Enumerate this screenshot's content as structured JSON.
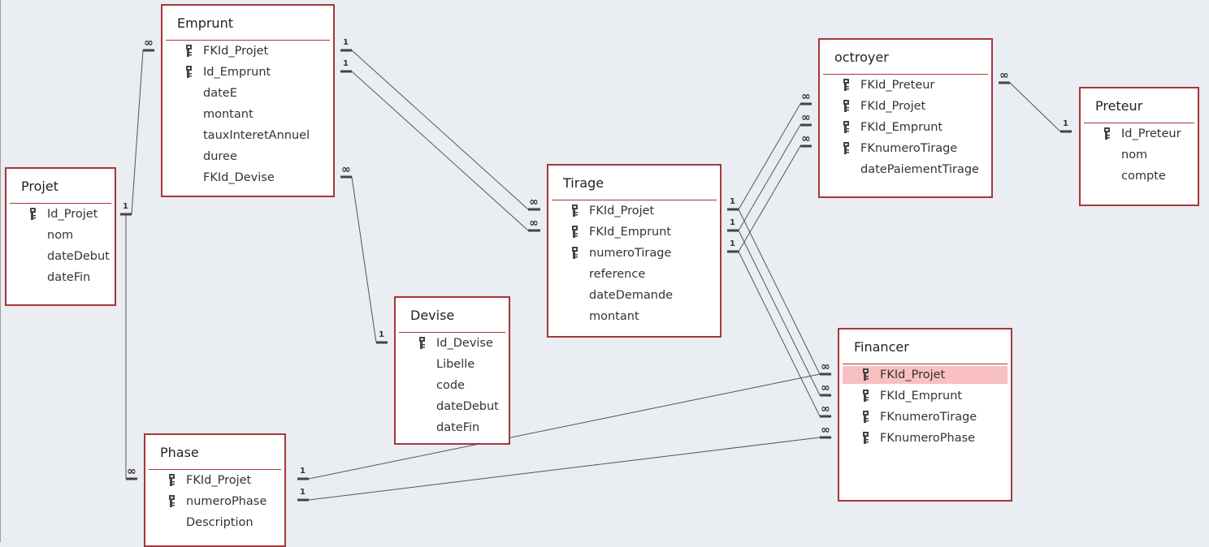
{
  "tables": [
    {
      "id": "emprunt",
      "title": "Emprunt",
      "fields": [
        {
          "name": "FKId_Projet",
          "key": true
        },
        {
          "name": "Id_Emprunt",
          "key": true
        },
        {
          "name": "dateE",
          "key": false
        },
        {
          "name": "montant",
          "key": false
        },
        {
          "name": "tauxInteretAnnuel",
          "key": false
        },
        {
          "name": "duree",
          "key": false
        },
        {
          "name": "FKId_Devise",
          "key": false
        }
      ]
    },
    {
      "id": "projet",
      "title": "Projet",
      "fields": [
        {
          "name": "Id_Projet",
          "key": true
        },
        {
          "name": "nom",
          "key": false
        },
        {
          "name": "dateDebut",
          "key": false
        },
        {
          "name": "dateFin",
          "key": false
        }
      ]
    },
    {
      "id": "devise",
      "title": "Devise",
      "fields": [
        {
          "name": "Id_Devise",
          "key": true
        },
        {
          "name": "Libelle",
          "key": false
        },
        {
          "name": "code",
          "key": false
        },
        {
          "name": "dateDebut",
          "key": false
        },
        {
          "name": "dateFin",
          "key": false
        }
      ]
    },
    {
      "id": "phase",
      "title": "Phase",
      "fields": [
        {
          "name": "FKId_Projet",
          "key": true
        },
        {
          "name": "numeroPhase",
          "key": true
        },
        {
          "name": "Description",
          "key": false
        }
      ]
    },
    {
      "id": "tirage",
      "title": "Tirage",
      "fields": [
        {
          "name": "FKId_Projet",
          "key": true
        },
        {
          "name": "FKId_Emprunt",
          "key": true
        },
        {
          "name": "numeroTirage",
          "key": true
        },
        {
          "name": "reference",
          "key": false
        },
        {
          "name": "dateDemande",
          "key": false
        },
        {
          "name": "montant",
          "key": false
        }
      ]
    },
    {
      "id": "octroyer",
      "title": "octroyer",
      "fields": [
        {
          "name": "FKId_Preteur",
          "key": true
        },
        {
          "name": "FKId_Projet",
          "key": true
        },
        {
          "name": "FKId_Emprunt",
          "key": true
        },
        {
          "name": "FKnumeroTirage",
          "key": true
        },
        {
          "name": "datePaiementTirage",
          "key": false
        }
      ]
    },
    {
      "id": "preteur",
      "title": "Preteur",
      "fields": [
        {
          "name": "Id_Preteur",
          "key": true
        },
        {
          "name": "nom",
          "key": false
        },
        {
          "name": "compte",
          "key": false
        }
      ]
    },
    {
      "id": "financer",
      "title": "Financer",
      "fields": [
        {
          "name": "FKId_Projet",
          "key": true,
          "selected": true
        },
        {
          "name": "FKId_Emprunt",
          "key": true
        },
        {
          "name": "FKnumeroTirage",
          "key": true
        },
        {
          "name": "FKnumeroPhase",
          "key": true
        }
      ]
    }
  ],
  "cardinality": {
    "one": "1",
    "many": "∞"
  },
  "colors": {
    "table_border": "#a4373a",
    "selected_row": "#f9c0c2",
    "background": "#eaedf1",
    "line": "#555555"
  }
}
